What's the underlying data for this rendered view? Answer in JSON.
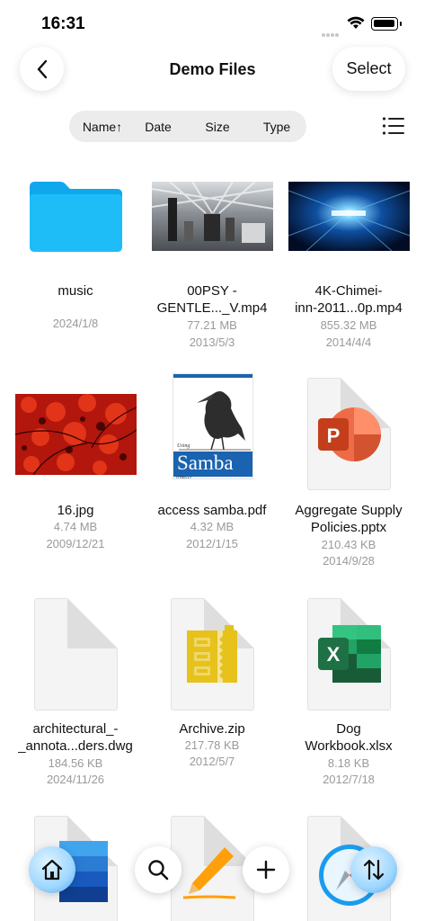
{
  "status": {
    "time": "16:31"
  },
  "header": {
    "title": "Demo Files",
    "select_label": "Select"
  },
  "sort": {
    "name": "Name↑",
    "date": "Date",
    "size": "Size",
    "type": "Type"
  },
  "files": [
    {
      "name": "music",
      "size": "",
      "date": "2024/1/8",
      "kind": "folder"
    },
    {
      "name": "00PSY -\nGENTLE..._V.mp4",
      "size": "77.21 MB",
      "date": "2013/5/3",
      "kind": "video"
    },
    {
      "name": "4K-Chimei-\ninn-2011...0p.mp4",
      "size": "855.32 MB",
      "date": "2014/4/4",
      "kind": "video"
    },
    {
      "name": "16.jpg",
      "size": "4.74 MB",
      "date": "2009/12/21",
      "kind": "image"
    },
    {
      "name": "access samba.pdf",
      "size": "4.32 MB",
      "date": "2012/1/15",
      "kind": "pdf"
    },
    {
      "name": "Aggregate Supply\nPolicies.pptx",
      "size": "210.43 KB",
      "date": "2014/9/28",
      "kind": "pptx"
    },
    {
      "name": "architectural_-\n_annota...ders.dwg",
      "size": "184.56 KB",
      "date": "2024/11/26",
      "kind": "dwg"
    },
    {
      "name": "Archive.zip",
      "size": "217.78 KB",
      "date": "2012/5/7",
      "kind": "zip"
    },
    {
      "name": "Dog\nWorkbook.xlsx",
      "size": "8.18 KB",
      "date": "2012/7/18",
      "kind": "xlsx"
    }
  ],
  "pdf_cover": {
    "title": "Samba",
    "top_line": "Using",
    "publisher": "O'REILLY"
  },
  "pptx_icon": "P",
  "xlsx_icon": "X",
  "colors": {
    "folder": "#1ab3f0",
    "pptx": "#c43e1c",
    "xlsx": "#1e7145",
    "zip": "#e6c21a"
  }
}
